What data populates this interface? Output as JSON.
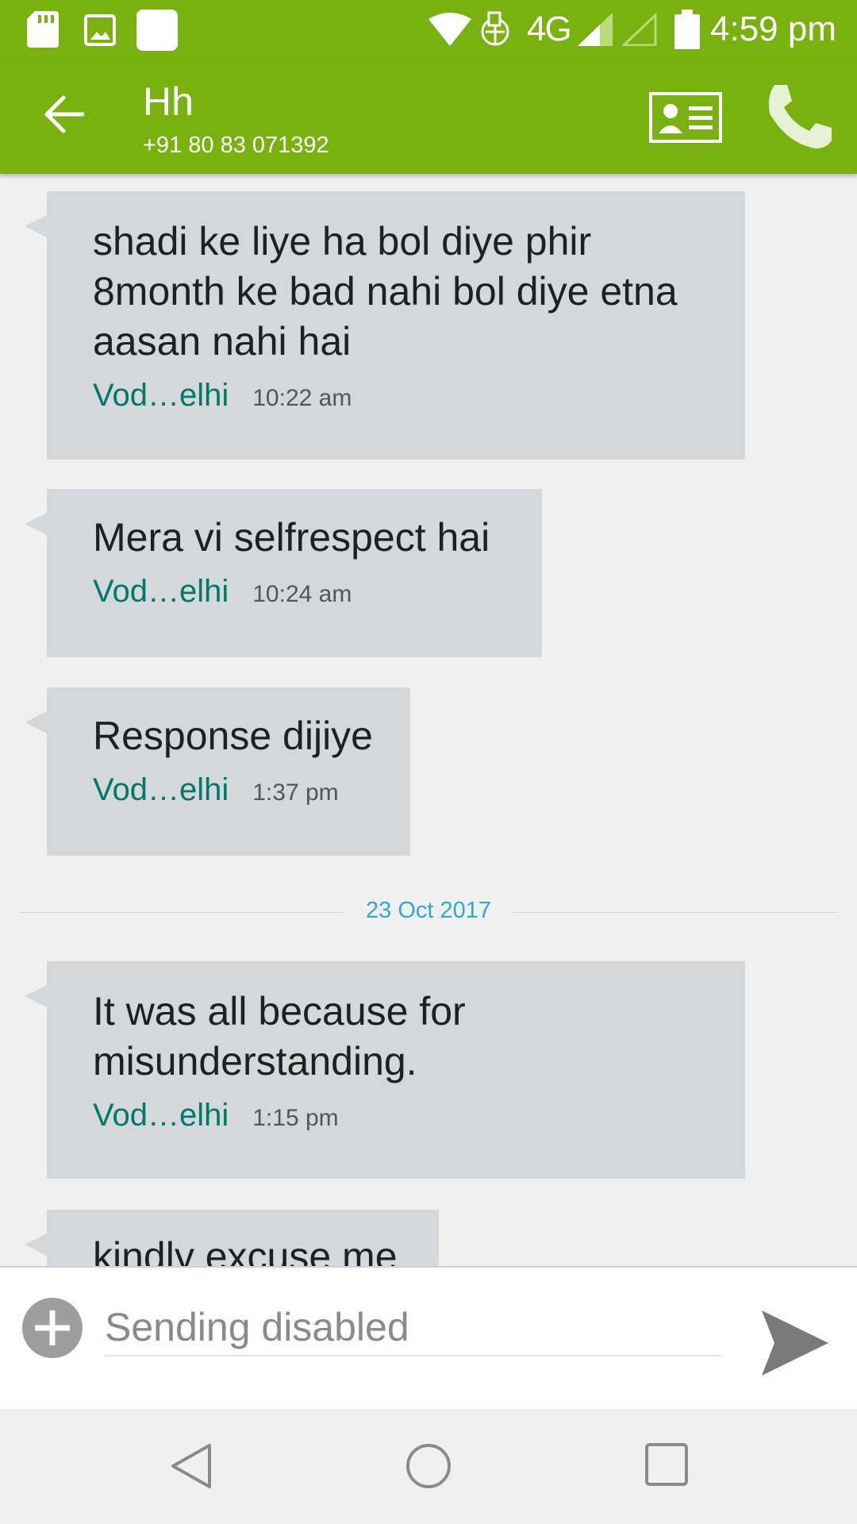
{
  "status_bar": {
    "network": "4G",
    "time": "4:59 pm"
  },
  "header": {
    "contact_name": "Hh",
    "contact_number": "+91 80 83 071392"
  },
  "messages": [
    {
      "text": "shadi ke liye ha bol diye phir 8month ke bad nahi bol diye etna aasan nahi hai",
      "sim": "Vod…elhi",
      "time": "10:22 am"
    },
    {
      "text": "Mera vi selfrespect hai",
      "sim": "Vod…elhi",
      "time": "10:24 am"
    },
    {
      "text": "Response dijiye",
      "sim": "Vod…elhi",
      "time": "1:37 pm"
    },
    {
      "text": "It was all because for misunderstanding.",
      "sim": "Vod…elhi",
      "time": "1:15 pm"
    },
    {
      "text": "kindly excuse me"
    }
  ],
  "date_separator": "23 Oct 2017",
  "compose": {
    "placeholder": "Sending disabled"
  },
  "colors": {
    "app_bar": "#78b110",
    "bubble": "#d5d8da",
    "sim_label": "#00796b",
    "date_separator": "#2ea8d7"
  }
}
